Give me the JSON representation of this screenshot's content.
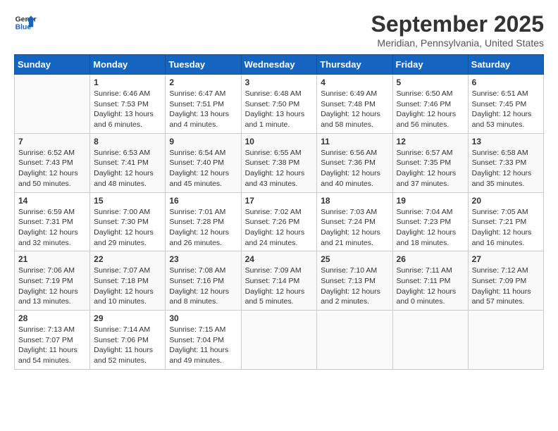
{
  "header": {
    "logo_general": "General",
    "logo_blue": "Blue",
    "month_title": "September 2025",
    "location": "Meridian, Pennsylvania, United States"
  },
  "days_of_week": [
    "Sunday",
    "Monday",
    "Tuesday",
    "Wednesday",
    "Thursday",
    "Friday",
    "Saturday"
  ],
  "weeks": [
    [
      {
        "day": "",
        "info": ""
      },
      {
        "day": "1",
        "info": "Sunrise: 6:46 AM\nSunset: 7:53 PM\nDaylight: 13 hours\nand 6 minutes."
      },
      {
        "day": "2",
        "info": "Sunrise: 6:47 AM\nSunset: 7:51 PM\nDaylight: 13 hours\nand 4 minutes."
      },
      {
        "day": "3",
        "info": "Sunrise: 6:48 AM\nSunset: 7:50 PM\nDaylight: 13 hours\nand 1 minute."
      },
      {
        "day": "4",
        "info": "Sunrise: 6:49 AM\nSunset: 7:48 PM\nDaylight: 12 hours\nand 58 minutes."
      },
      {
        "day": "5",
        "info": "Sunrise: 6:50 AM\nSunset: 7:46 PM\nDaylight: 12 hours\nand 56 minutes."
      },
      {
        "day": "6",
        "info": "Sunrise: 6:51 AM\nSunset: 7:45 PM\nDaylight: 12 hours\nand 53 minutes."
      }
    ],
    [
      {
        "day": "7",
        "info": "Sunrise: 6:52 AM\nSunset: 7:43 PM\nDaylight: 12 hours\nand 50 minutes."
      },
      {
        "day": "8",
        "info": "Sunrise: 6:53 AM\nSunset: 7:41 PM\nDaylight: 12 hours\nand 48 minutes."
      },
      {
        "day": "9",
        "info": "Sunrise: 6:54 AM\nSunset: 7:40 PM\nDaylight: 12 hours\nand 45 minutes."
      },
      {
        "day": "10",
        "info": "Sunrise: 6:55 AM\nSunset: 7:38 PM\nDaylight: 12 hours\nand 43 minutes."
      },
      {
        "day": "11",
        "info": "Sunrise: 6:56 AM\nSunset: 7:36 PM\nDaylight: 12 hours\nand 40 minutes."
      },
      {
        "day": "12",
        "info": "Sunrise: 6:57 AM\nSunset: 7:35 PM\nDaylight: 12 hours\nand 37 minutes."
      },
      {
        "day": "13",
        "info": "Sunrise: 6:58 AM\nSunset: 7:33 PM\nDaylight: 12 hours\nand 35 minutes."
      }
    ],
    [
      {
        "day": "14",
        "info": "Sunrise: 6:59 AM\nSunset: 7:31 PM\nDaylight: 12 hours\nand 32 minutes."
      },
      {
        "day": "15",
        "info": "Sunrise: 7:00 AM\nSunset: 7:30 PM\nDaylight: 12 hours\nand 29 minutes."
      },
      {
        "day": "16",
        "info": "Sunrise: 7:01 AM\nSunset: 7:28 PM\nDaylight: 12 hours\nand 26 minutes."
      },
      {
        "day": "17",
        "info": "Sunrise: 7:02 AM\nSunset: 7:26 PM\nDaylight: 12 hours\nand 24 minutes."
      },
      {
        "day": "18",
        "info": "Sunrise: 7:03 AM\nSunset: 7:24 PM\nDaylight: 12 hours\nand 21 minutes."
      },
      {
        "day": "19",
        "info": "Sunrise: 7:04 AM\nSunset: 7:23 PM\nDaylight: 12 hours\nand 18 minutes."
      },
      {
        "day": "20",
        "info": "Sunrise: 7:05 AM\nSunset: 7:21 PM\nDaylight: 12 hours\nand 16 minutes."
      }
    ],
    [
      {
        "day": "21",
        "info": "Sunrise: 7:06 AM\nSunset: 7:19 PM\nDaylight: 12 hours\nand 13 minutes."
      },
      {
        "day": "22",
        "info": "Sunrise: 7:07 AM\nSunset: 7:18 PM\nDaylight: 12 hours\nand 10 minutes."
      },
      {
        "day": "23",
        "info": "Sunrise: 7:08 AM\nSunset: 7:16 PM\nDaylight: 12 hours\nand 8 minutes."
      },
      {
        "day": "24",
        "info": "Sunrise: 7:09 AM\nSunset: 7:14 PM\nDaylight: 12 hours\nand 5 minutes."
      },
      {
        "day": "25",
        "info": "Sunrise: 7:10 AM\nSunset: 7:13 PM\nDaylight: 12 hours\nand 2 minutes."
      },
      {
        "day": "26",
        "info": "Sunrise: 7:11 AM\nSunset: 7:11 PM\nDaylight: 12 hours\nand 0 minutes."
      },
      {
        "day": "27",
        "info": "Sunrise: 7:12 AM\nSunset: 7:09 PM\nDaylight: 11 hours\nand 57 minutes."
      }
    ],
    [
      {
        "day": "28",
        "info": "Sunrise: 7:13 AM\nSunset: 7:07 PM\nDaylight: 11 hours\nand 54 minutes."
      },
      {
        "day": "29",
        "info": "Sunrise: 7:14 AM\nSunset: 7:06 PM\nDaylight: 11 hours\nand 52 minutes."
      },
      {
        "day": "30",
        "info": "Sunrise: 7:15 AM\nSunset: 7:04 PM\nDaylight: 11 hours\nand 49 minutes."
      },
      {
        "day": "",
        "info": ""
      },
      {
        "day": "",
        "info": ""
      },
      {
        "day": "",
        "info": ""
      },
      {
        "day": "",
        "info": ""
      }
    ]
  ]
}
